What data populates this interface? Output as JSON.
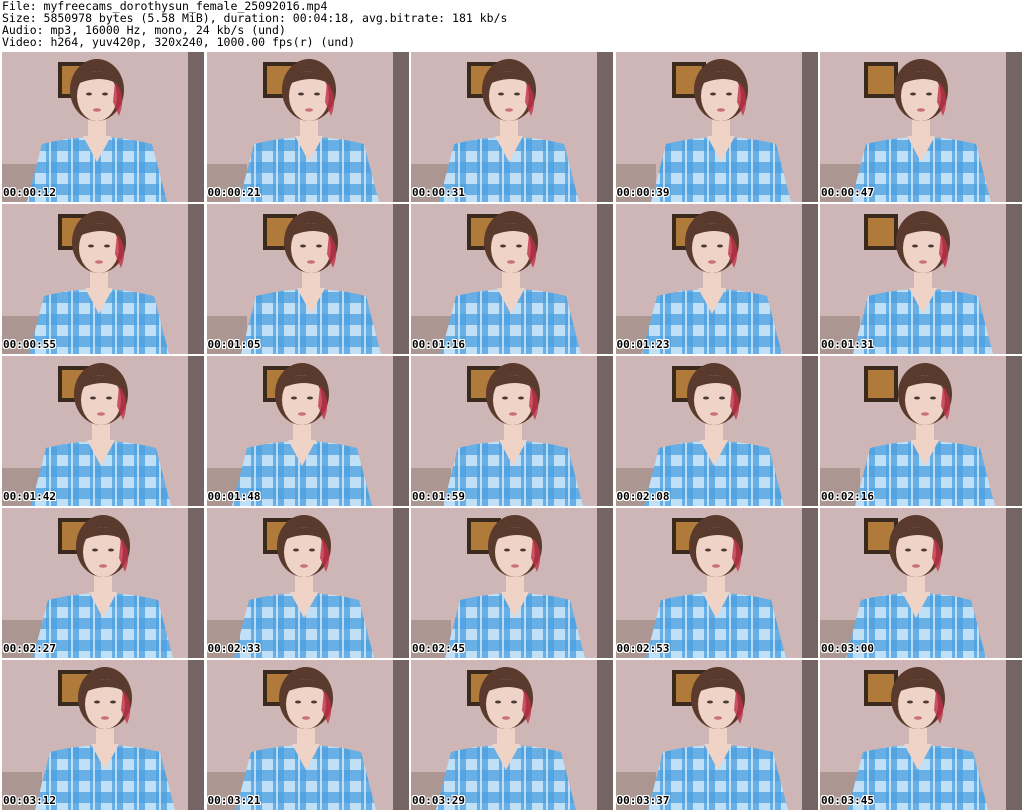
{
  "header": {
    "line1": "File: myfreecams_dorothysun_female_25092016.mp4",
    "line2": "Size: 5850978 bytes (5.58 MiB), duration: 00:04:18, avg.bitrate: 181 kb/s",
    "line3": "Audio: mp3, 16000 Hz, mono, 24 kb/s (und)",
    "line4": "Video: h264, yuv420p, 320x240, 1000.00 fps(r) (und)"
  },
  "thumbnails": [
    {
      "timestamp": "00:00:12"
    },
    {
      "timestamp": "00:00:21"
    },
    {
      "timestamp": "00:00:31"
    },
    {
      "timestamp": "00:00:39"
    },
    {
      "timestamp": "00:00:47"
    },
    {
      "timestamp": "00:00:55"
    },
    {
      "timestamp": "00:01:05"
    },
    {
      "timestamp": "00:01:16"
    },
    {
      "timestamp": "00:01:23"
    },
    {
      "timestamp": "00:01:31"
    },
    {
      "timestamp": "00:01:42"
    },
    {
      "timestamp": "00:01:48"
    },
    {
      "timestamp": "00:01:59"
    },
    {
      "timestamp": "00:02:08"
    },
    {
      "timestamp": "00:02:16"
    },
    {
      "timestamp": "00:02:27"
    },
    {
      "timestamp": "00:02:33"
    },
    {
      "timestamp": "00:02:45"
    },
    {
      "timestamp": "00:02:53"
    },
    {
      "timestamp": "00:03:00"
    },
    {
      "timestamp": "00:03:12"
    },
    {
      "timestamp": "00:03:21"
    },
    {
      "timestamp": "00:03:29"
    },
    {
      "timestamp": "00:03:37"
    },
    {
      "timestamp": "00:03:45"
    }
  ],
  "colors": {
    "wall": "#cdb6b5",
    "shirt": "#4a9fe0",
    "shirt_light": "#bfe0f7",
    "hair": "#5a3a2c",
    "hair_highlight": "#c0314a",
    "skin": "#efd3c6",
    "frame": "#3a2a1e",
    "door": "#2b2220"
  }
}
